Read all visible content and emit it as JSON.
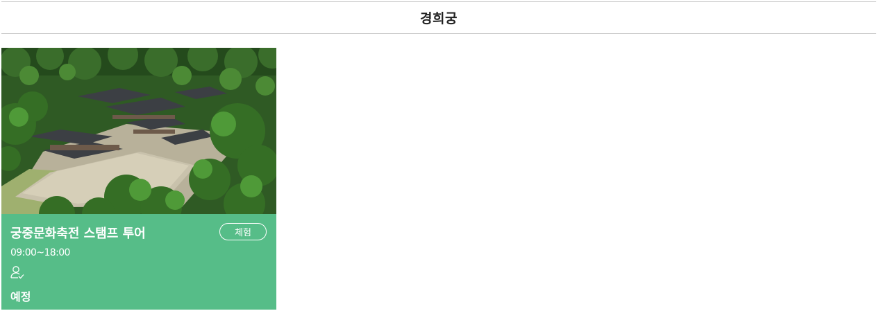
{
  "header": {
    "title": "경희궁"
  },
  "card": {
    "title": "궁중문화축전 스탬프 투어",
    "badge": "체험",
    "time": "09:00~18:00",
    "status": "예정",
    "icon": "user-check-icon",
    "image": "aerial-palace-photo"
  },
  "colors": {
    "card_bg": "#56bd88",
    "text_on_card": "#ffffff",
    "header_text": "#222222",
    "divider": "#c8c8c8"
  }
}
